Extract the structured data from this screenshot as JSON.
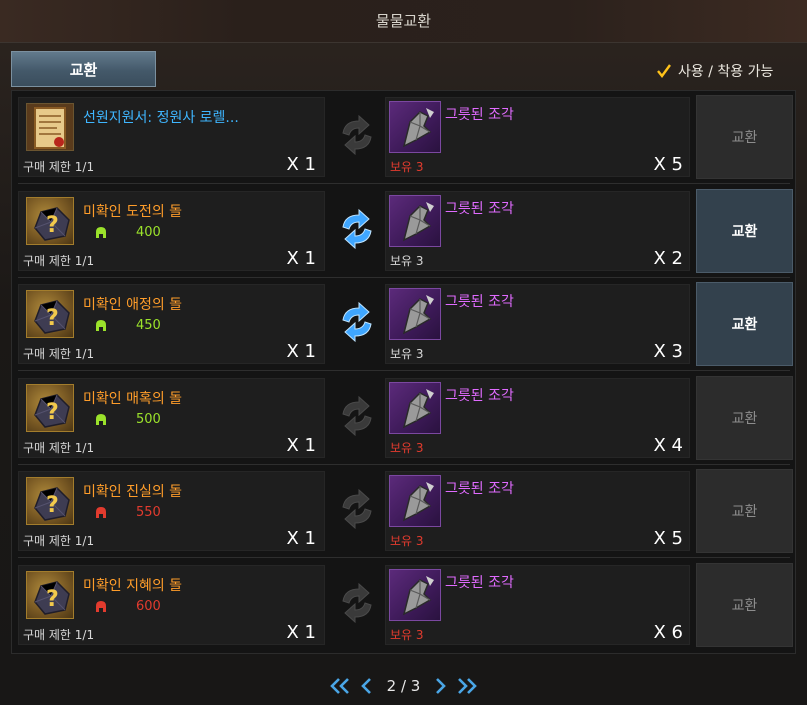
{
  "window": {
    "title": "물물교환"
  },
  "tab": {
    "label": "교환"
  },
  "filter": {
    "label": "사용 / 착용 가능",
    "checked": true
  },
  "colors": {
    "accent_active": "#3fb6ff",
    "fragment_purple": "#e06bff",
    "owned_insufficient": "#e23b2e",
    "cost_ok": "#9be22b",
    "cost_insufficient": "#e23b2e"
  },
  "rows": [
    {
      "offer_name": "선원지원서: 정원사 로렐...",
      "offer_icon": "scroll-icon",
      "offer_cost": null,
      "limit": "구매 제한 1/1",
      "offer_qty": "X 1",
      "req_name": "그릇된 조각",
      "owned": "보유 3",
      "owned_sufficient": false,
      "req_qty": "X 5",
      "swap_active": false,
      "button": "교환",
      "button_enabled": false
    },
    {
      "offer_name": "미확인 도전의 돌",
      "offer_icon": "stone-icon",
      "offer_cost": "400",
      "cost_ok": true,
      "limit": "구매 제한 1/1",
      "offer_qty": "X 1",
      "req_name": "그릇된 조각",
      "owned": "보유 3",
      "owned_sufficient": true,
      "req_qty": "X 2",
      "swap_active": true,
      "button": "교환",
      "button_enabled": true
    },
    {
      "offer_name": "미확인 애정의 돌",
      "offer_icon": "stone-icon",
      "offer_cost": "450",
      "cost_ok": true,
      "limit": "구매 제한 1/1",
      "offer_qty": "X 1",
      "req_name": "그릇된 조각",
      "owned": "보유 3",
      "owned_sufficient": true,
      "req_qty": "X 3",
      "swap_active": true,
      "button": "교환",
      "button_enabled": true
    },
    {
      "offer_name": "미확인 매혹의 돌",
      "offer_icon": "stone-icon",
      "offer_cost": "500",
      "cost_ok": true,
      "limit": "구매 제한 1/1",
      "offer_qty": "X 1",
      "req_name": "그릇된 조각",
      "owned": "보유 3",
      "owned_sufficient": false,
      "req_qty": "X 4",
      "swap_active": false,
      "button": "교환",
      "button_enabled": false
    },
    {
      "offer_name": "미확인 진실의 돌",
      "offer_icon": "stone-icon",
      "offer_cost": "550",
      "cost_ok": false,
      "limit": "구매 제한 1/1",
      "offer_qty": "X 1",
      "req_name": "그릇된 조각",
      "owned": "보유 3",
      "owned_sufficient": false,
      "req_qty": "X 5",
      "swap_active": false,
      "button": "교환",
      "button_enabled": false
    },
    {
      "offer_name": "미확인 지혜의 돌",
      "offer_icon": "stone-icon",
      "offer_cost": "600",
      "cost_ok": false,
      "limit": "구매 제한 1/1",
      "offer_qty": "X 1",
      "req_name": "그릇된 조각",
      "owned": "보유 3",
      "owned_sufficient": false,
      "req_qty": "X 6",
      "swap_active": false,
      "button": "교환",
      "button_enabled": false
    }
  ],
  "pager": {
    "current": "2 / 3"
  }
}
